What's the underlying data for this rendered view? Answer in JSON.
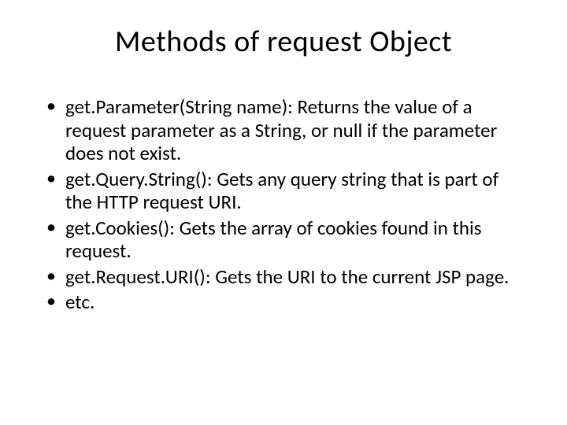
{
  "title": "Methods of request Object",
  "bullets": [
    " get.Parameter(String name): Returns the value of a request parameter as a String, or null if the parameter does not exist.",
    "get.Query.String(): Gets any query string that is part of the HTTP request URI.",
    "get.Cookies(): Gets the array of cookies found in this request.",
    "get.Request.URI(): Gets the URI to the current JSP page.",
    "etc."
  ]
}
